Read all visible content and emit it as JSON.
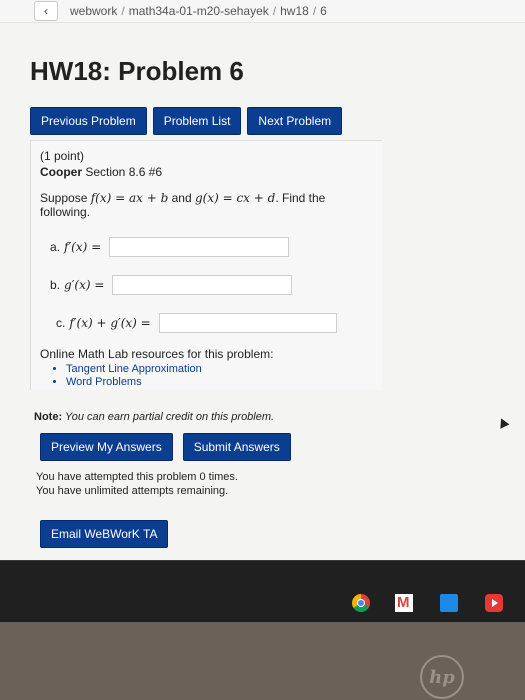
{
  "breadcrumb": {
    "back": "‹",
    "items": [
      "webwork",
      "math34a-01-m20-sehayek",
      "hw18",
      "6"
    ]
  },
  "page_title": "HW18: Problem 6",
  "nav": {
    "previous": "Previous Problem",
    "list": "Problem List",
    "next": "Next Problem"
  },
  "problem": {
    "points": "(1 point)",
    "section_bold": "Cooper",
    "section_rest": " Section 8.6 #6",
    "statement_prefix": "Suppose ",
    "f_def": "f(x) = ax + b",
    "statement_mid": " and ",
    "g_def": "g(x) = cx + d",
    "statement_suffix": ". Find the following.",
    "parts": [
      {
        "prefix": "a.",
        "expr": "f′(x) ="
      },
      {
        "prefix": "b.",
        "expr": "g′(x) ="
      },
      {
        "prefix": "c.",
        "expr": "f′(x) + g′(x) ="
      }
    ],
    "resources_title": "Online Math Lab resources for this problem:",
    "resources": [
      "Tangent Line Approximation",
      "Word Problems"
    ]
  },
  "note": {
    "label": "Note:",
    "text": " You can earn partial credit on this problem."
  },
  "actions": {
    "preview": "Preview My Answers",
    "submit": "Submit Answers"
  },
  "attempts": {
    "line1": "You have attempted this problem 0 times.",
    "line2": "You have unlimited attempts remaining."
  },
  "email": "Email WeBWorK TA",
  "brand": {
    "nav_button_color": "#0b3d91"
  },
  "taskbar_icons": [
    "chrome-icon",
    "gmail-icon",
    "docs-icon",
    "youtube-icon"
  ],
  "bezel_logo": "hp"
}
